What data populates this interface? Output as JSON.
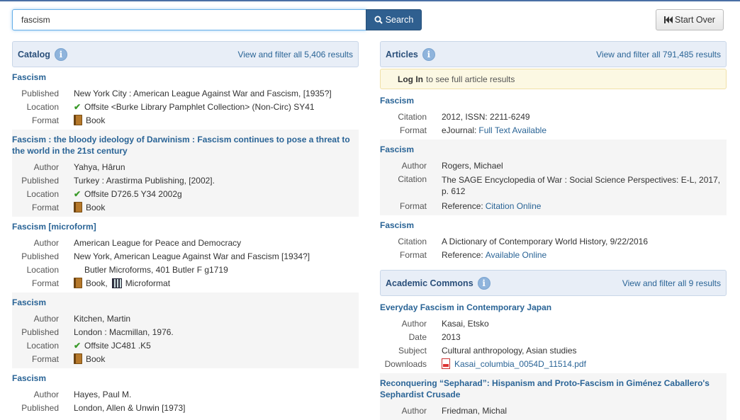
{
  "search": {
    "query": "fascism",
    "button_label": "Search",
    "start_over_label": "Start Over"
  },
  "catalog": {
    "title": "Catalog",
    "view_all": "View and filter all 5,406 results",
    "results": [
      {
        "title": "Fascism",
        "published": "New York City : American League Against War and Fascism, [1935?]",
        "location": "Offsite <Burke Library Pamphlet Collection> (Non-Circ) SY41",
        "format": "Book"
      },
      {
        "title": "Fascism : the bloody ideology of Darwinism : Fascism continues to pose a threat to the world in the 21st century",
        "author": "Yahya, Hârun",
        "published": "Turkey : Arastirma Publishing, [2002].",
        "location": "Offsite D726.5 Y34 2002g",
        "format": "Book"
      },
      {
        "title": "Fascism [microform]",
        "author": "American League for Peace and Democracy",
        "published": "New York, American League Against War and Fascism [1934?]",
        "location": "Butler Microforms, 401 Butler F g1719",
        "format_1": "Book,",
        "format_2": "Microformat"
      },
      {
        "title": "Fascism",
        "author": "Kitchen, Martin",
        "published": "London : Macmillan, 1976.",
        "location": "Offsite JC481 .K5",
        "format": "Book"
      },
      {
        "title": "Fascism",
        "author": "Hayes, Paul M.",
        "published": "London, Allen & Unwin [1973]"
      }
    ]
  },
  "articles": {
    "title": "Articles",
    "view_all": "View and filter all 791,485 results",
    "login_link": "Log In",
    "login_text": "to see full article results",
    "results": [
      {
        "title": "Fascism",
        "citation": "2012, ISSN: 2211-6249",
        "format_prefix": "eJournal:",
        "format_link": "Full Text Available"
      },
      {
        "title": "Fascism",
        "author": "Rogers, Michael",
        "citation": "The SAGE Encyclopedia of War : Social Science Perspectives: E-L, 2017, p. 612",
        "format_prefix": "Reference:",
        "format_link": "Citation Online"
      },
      {
        "title": "Fascism",
        "citation": "A Dictionary of Contemporary World History, 9/22/2016",
        "format_prefix": "Reference:",
        "format_link": "Available Online"
      }
    ]
  },
  "academic_commons": {
    "title": "Academic Commons",
    "view_all": "View and filter all 9 results",
    "results": [
      {
        "title": "Everyday Fascism in Contemporary Japan",
        "author": "Kasai, Etsko",
        "date": "2013",
        "subject": "Cultural anthropology, Asian studies",
        "download": "Kasai_columbia_0054D_11514.pdf"
      },
      {
        "title": "Reconquering “Sepharad”: Hispanism and Proto-Fascism in Giménez Caballero's Sephardist Crusade",
        "author": "Friedman, Michal"
      }
    ]
  },
  "labels": {
    "published": "Published",
    "location": "Location",
    "format": "Format",
    "author": "Author",
    "citation": "Citation",
    "date": "Date",
    "subject": "Subject",
    "downloads": "Downloads"
  },
  "icons": {
    "info": "i",
    "check": "✔",
    "search": "search-icon",
    "backward": "backward-icon"
  }
}
